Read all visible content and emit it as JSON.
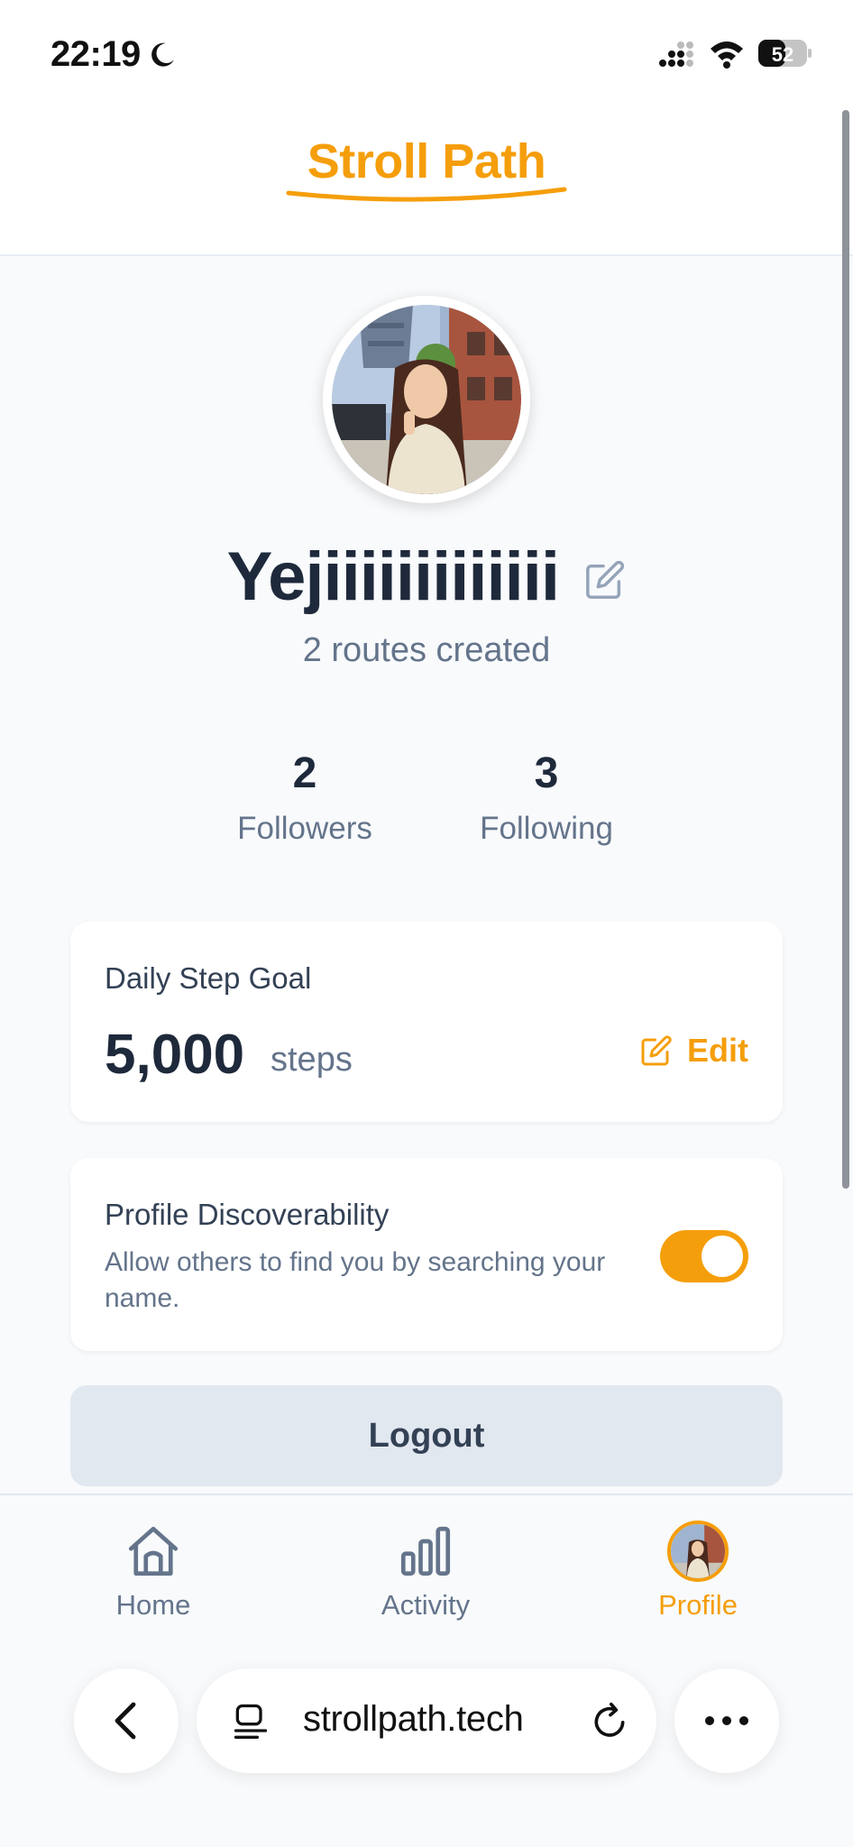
{
  "status_bar": {
    "time": "22:19",
    "battery": "52"
  },
  "header": {
    "brand": "Stroll Path"
  },
  "profile": {
    "name": "Yejiiiiiiiiiiiii",
    "routes_created": "2 routes created",
    "followers_count": "2",
    "followers_label": "Followers",
    "following_count": "3",
    "following_label": "Following"
  },
  "step_goal": {
    "title": "Daily Step Goal",
    "value": "5,000",
    "unit": "steps",
    "edit_label": "Edit"
  },
  "discoverability": {
    "title": "Profile Discoverability",
    "description": "Allow others to find you by searching your name.",
    "enabled": true
  },
  "logout_label": "Logout",
  "nav": {
    "home": "Home",
    "activity": "Activity",
    "profile": "Profile"
  },
  "browser": {
    "url": "strollpath.tech"
  },
  "colors": {
    "accent": "#f59e0b",
    "text_dark": "#1e293b",
    "text_muted": "#64748b",
    "background": "#f8fafc"
  }
}
